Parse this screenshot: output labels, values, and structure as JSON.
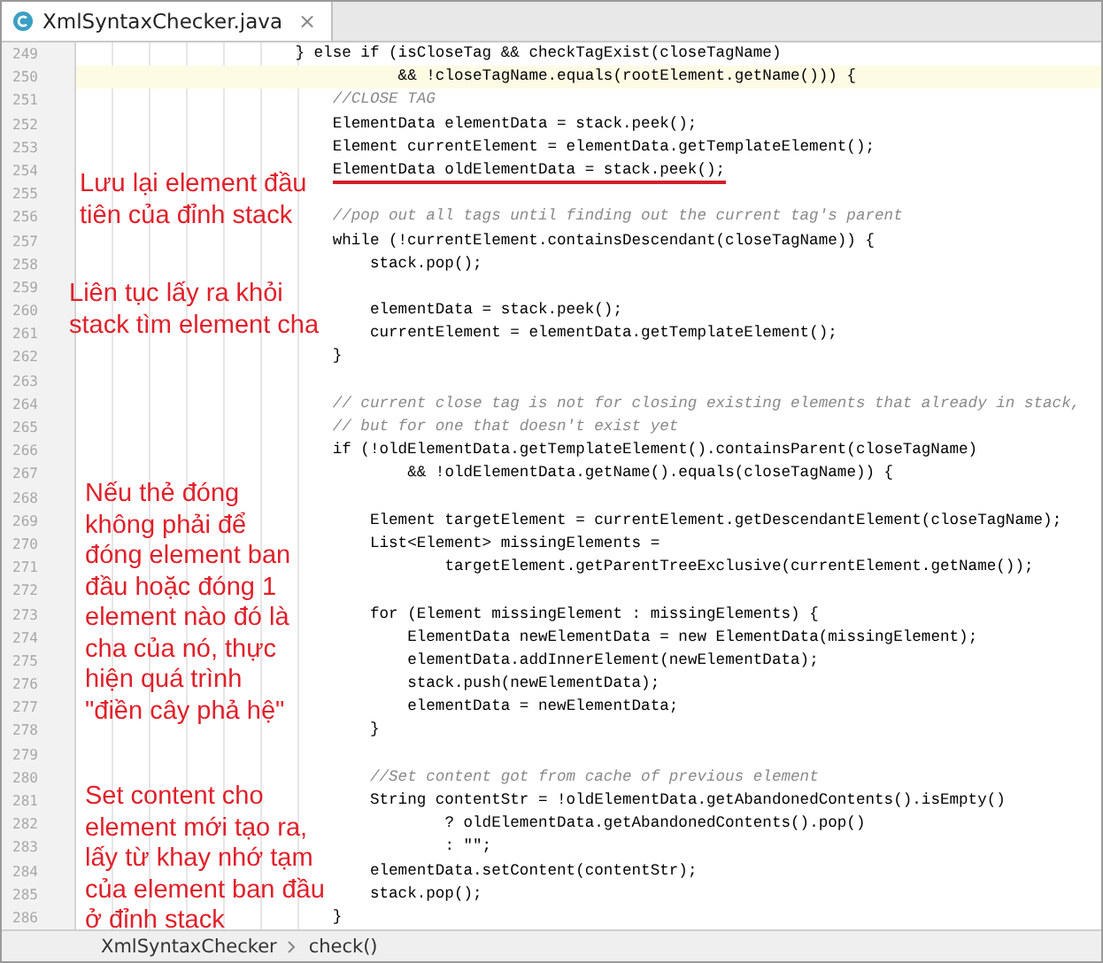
{
  "tabs": [
    {
      "label": "XmlSyntaxChecker.java",
      "selected": true,
      "close": "×"
    }
  ],
  "editor": {
    "lines": [
      {
        "number": "249",
        "text": "} else if (isCloseTag && checkTagExist(closeTagName)",
        "kind": "code",
        "current": false,
        "underlined": false
      },
      {
        "number": "250",
        "text": "&& !closeTagName.equals(rootElement.getName())) {",
        "kind": "continuation",
        "current": true,
        "underlined": false,
        "children": [
          {
            "number": "251",
            "text": "//CLOSE TAG",
            "kind": "comment",
            "current": false,
            "underlined": false
          },
          {
            "number": "252",
            "text": "ElementData elementData = stack.peek();",
            "kind": "code",
            "current": false,
            "underlined": false
          },
          {
            "number": "253",
            "text": "Element currentElement = elementData.getTemplateElement();",
            "kind": "code",
            "current": false,
            "underlined": false
          },
          {
            "number": "254",
            "text": "ElementData oldElementData = stack.peek();",
            "kind": "code",
            "current": false,
            "underlined": true
          },
          {
            "number": "255",
            "kind": "blank",
            "current": false
          },
          {
            "number": "256",
            "text": "//pop out all tags until finding out the current tag's parent",
            "kind": "comment",
            "current": false,
            "underlined": false
          },
          {
            "number": "257",
            "text": "while (!currentElement.containsDescendant(closeTagName)) {",
            "kind": "code",
            "current": false,
            "underlined": false,
            "children": [
              {
                "number": "258",
                "text": "stack.pop();",
                "kind": "code",
                "current": false,
                "underlined": false
              },
              {
                "number": "259",
                "kind": "blank",
                "current": false
              },
              {
                "number": "260",
                "text": "elementData = stack.peek();",
                "kind": "code",
                "current": false,
                "underlined": false
              },
              {
                "number": "261",
                "text": "currentElement = elementData.getTemplateElement();",
                "kind": "code",
                "current": false,
                "underlined": false
              }
            ]
          },
          {
            "number": "262",
            "text": "}",
            "kind": "code",
            "current": false,
            "underlined": false
          },
          {
            "number": "263",
            "kind": "blank",
            "current": false
          },
          {
            "number": "264",
            "text": "// current close tag is not for closing existing elements that already in stack,",
            "kind": "comment",
            "current": false,
            "underlined": false
          },
          {
            "number": "265",
            "text": "// but for one that doesn't exist yet",
            "kind": "comment",
            "current": false,
            "underlined": false
          },
          {
            "number": "266",
            "text": "if (!oldElementData.getTemplateElement().containsParent(closeTagName)",
            "kind": "code",
            "current": false,
            "underlined": false
          },
          {
            "number": "267",
            "text": "&& !oldElementData.getName().equals(closeTagName)) {",
            "kind": "continuation",
            "current": false,
            "underlined": false,
            "children": [
              {
                "number": "268",
                "kind": "blank",
                "current": false
              },
              {
                "number": "269",
                "text": "Element targetElement = currentElement.getDescendantElement(closeTagName);",
                "kind": "code",
                "current": false,
                "underlined": false
              },
              {
                "number": "270",
                "text": "List<Element> missingElements =",
                "kind": "code",
                "current": false,
                "underlined": false
              },
              {
                "number": "271",
                "text": "targetElement.getParentTreeExclusive(currentElement.getName());",
                "kind": "continuation",
                "current": false,
                "underlined": false
              },
              {
                "number": "272",
                "kind": "blank",
                "current": false
              },
              {
                "number": "273",
                "text": "for (Element missingElement : missingElements) {",
                "kind": "code",
                "current": false,
                "underlined": false,
                "children": [
                  {
                    "number": "274",
                    "text": "ElementData newElementData = new ElementData(missingElement);",
                    "kind": "code",
                    "current": false,
                    "underlined": false
                  },
                  {
                    "number": "275",
                    "text": "elementData.addInnerElement(newElementData);",
                    "kind": "code",
                    "current": false,
                    "underlined": false
                  },
                  {
                    "number": "276",
                    "text": "stack.push(newElementData);",
                    "kind": "code",
                    "current": false,
                    "underlined": false
                  },
                  {
                    "number": "277",
                    "text": "elementData = newElementData;",
                    "kind": "code",
                    "current": false,
                    "underlined": false
                  }
                ]
              },
              {
                "number": "278",
                "text": "}",
                "kind": "code",
                "current": false,
                "underlined": false
              },
              {
                "number": "279",
                "kind": "blank",
                "current": false
              },
              {
                "number": "280",
                "text": "//Set content got from cache of previous element",
                "kind": "comment",
                "current": false,
                "underlined": false
              },
              {
                "number": "281",
                "text": "String contentStr = !oldElementData.getAbandonedContents().isEmpty()",
                "kind": "code",
                "current": false,
                "underlined": false
              },
              {
                "number": "282",
                "text": "? oldElementData.getAbandonedContents().pop()",
                "kind": "continuation",
                "current": false,
                "underlined": false
              },
              {
                "number": "283",
                "text": ": \"\";",
                "kind": "continuation",
                "current": false,
                "underlined": false
              },
              {
                "number": "284",
                "text": "elementData.setContent(contentStr);",
                "kind": "code",
                "current": false,
                "underlined": false
              },
              {
                "number": "285",
                "text": "stack.pop();",
                "kind": "code",
                "current": false,
                "underlined": false
              }
            ]
          },
          {
            "number": "286",
            "text": "}",
            "kind": "code",
            "current": false,
            "underlined": false
          }
        ]
      }
    ]
  },
  "annotations": [
    {
      "text": "Lưu lại element đầu\ntiên của đỉnh stack"
    },
    {
      "text": "Liên tục lấy ra khỏi\nstack tìm element cha"
    },
    {
      "text": "Nếu thẻ đóng\nkhông phải để\nđóng element ban\nđầu hoặc đóng 1\nelement nào đó là\ncha của nó, thực\nhiện quá trình\n\"điền cây phả hệ\""
    },
    {
      "text": "Set content cho\nelement mới tạo ra,\nlấy từ khay nhớ tạm\ncủa element ban đầu\nở đỉnh stack"
    }
  ],
  "breadcrumb": [
    {
      "label": "XmlSyntaxChecker"
    },
    {
      "label": "check()"
    }
  ]
}
